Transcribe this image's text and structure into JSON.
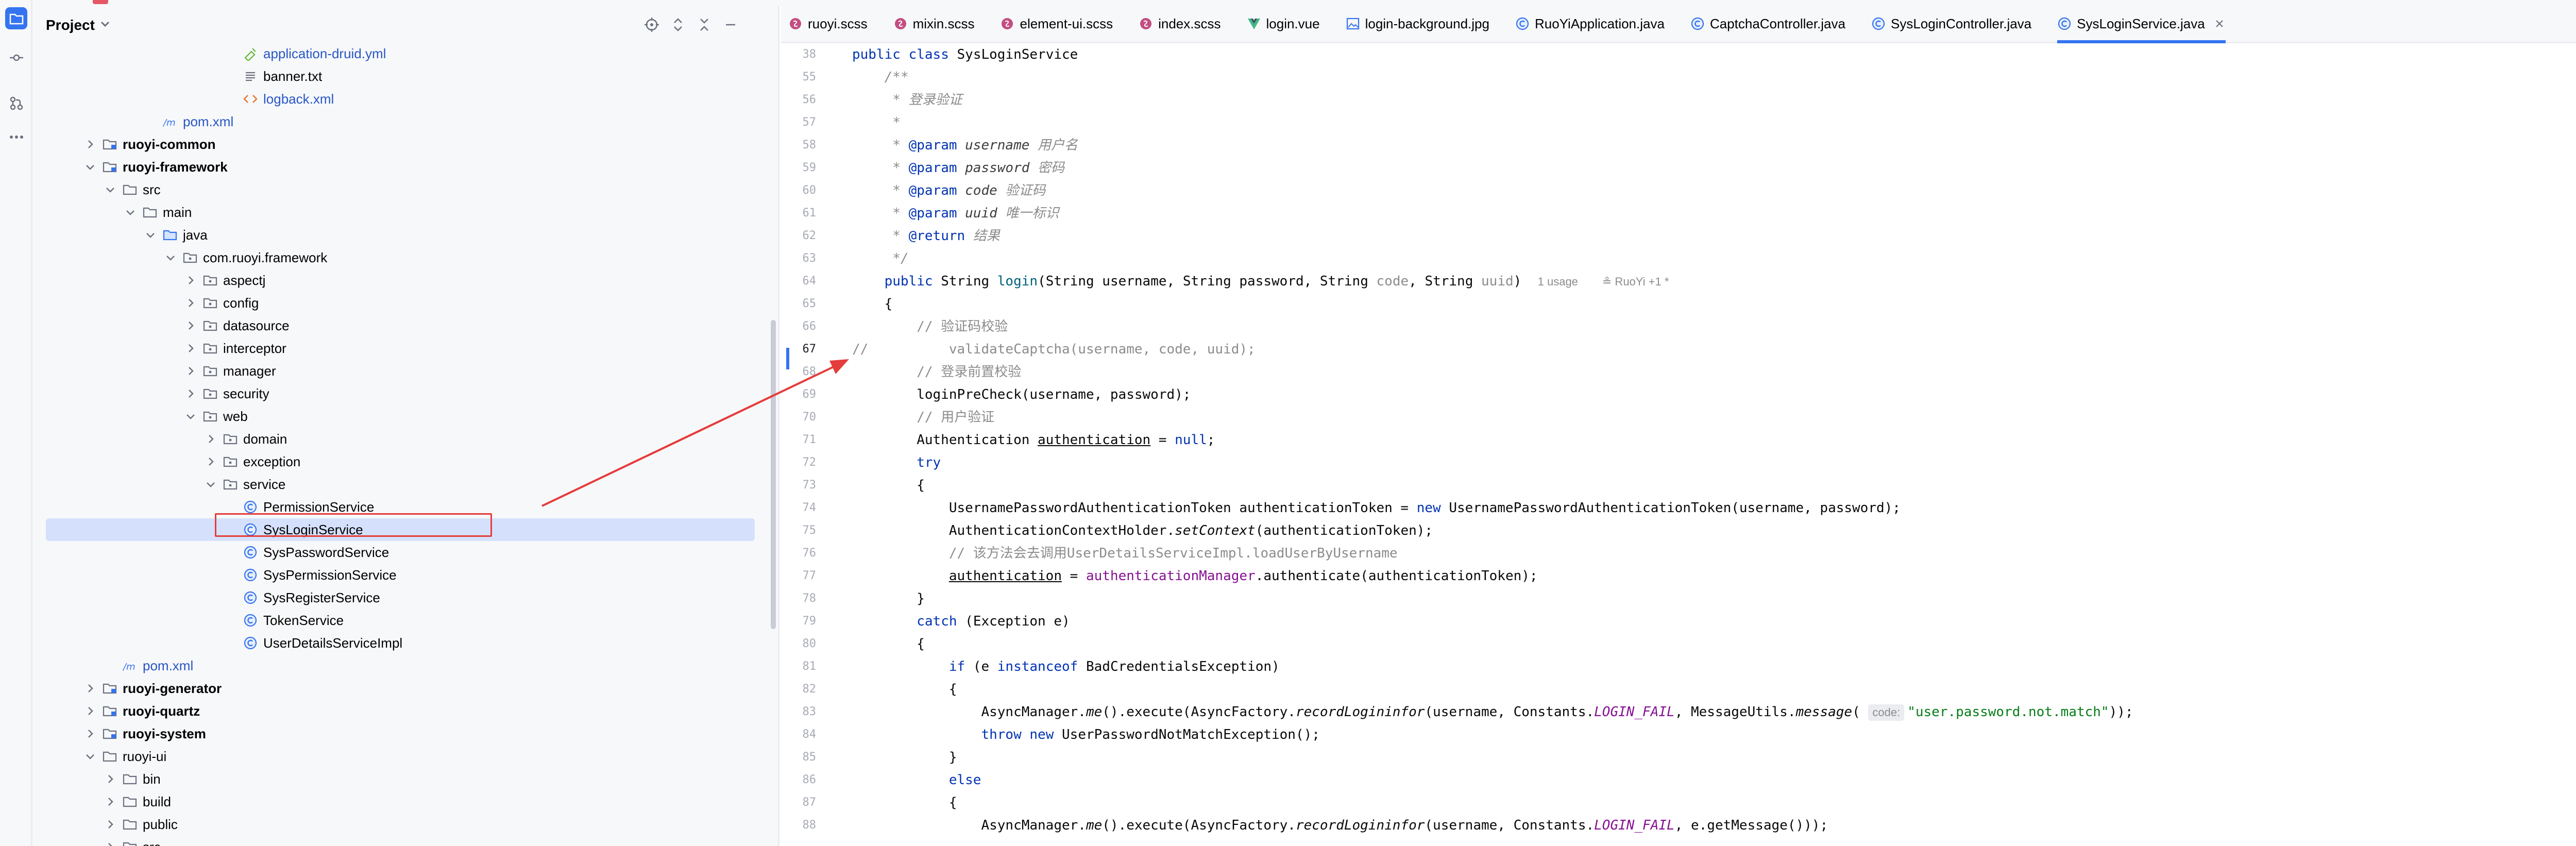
{
  "colors": {
    "accent": "#3574f0",
    "annotation_red": "#e53c3c",
    "keyword": "#0033b3",
    "comment": "#8c8c8c",
    "string": "#067d17",
    "method": "#00627a",
    "field": "#871094"
  },
  "activity_bar": {
    "icons": [
      "folder-icon",
      "commit-icon",
      "pull-requests-icon",
      "more-icon"
    ]
  },
  "project_panel": {
    "title": "Project",
    "header_icons": [
      "locate-icon",
      "expand-all-icon",
      "collapse-all-icon",
      "minimize-icon"
    ],
    "tree": [
      {
        "label": "application-druid.yml",
        "indent": 10,
        "arrow": "",
        "icon": "yaml-icon",
        "style": "blue"
      },
      {
        "label": "banner.txt",
        "indent": 10,
        "arrow": "",
        "icon": "text-icon",
        "style": ""
      },
      {
        "label": "logback.xml",
        "indent": 10,
        "arrow": "",
        "icon": "xml-icon",
        "style": "blue"
      },
      {
        "label": "pom.xml",
        "indent": 6,
        "arrow": "",
        "icon": "maven-icon",
        "style": "blue"
      },
      {
        "label": "ruoyi-common",
        "indent": 3,
        "arrow": "right",
        "icon": "module-icon",
        "style": "bold"
      },
      {
        "label": "ruoyi-framework",
        "indent": 3,
        "arrow": "down",
        "icon": "module-icon",
        "style": "bold"
      },
      {
        "label": "src",
        "indent": 4,
        "arrow": "down",
        "icon": "folder-icon",
        "style": ""
      },
      {
        "label": "main",
        "indent": 5,
        "arrow": "down",
        "icon": "folder-icon",
        "style": ""
      },
      {
        "label": "java",
        "indent": 6,
        "arrow": "down",
        "icon": "source-folder-icon",
        "style": ""
      },
      {
        "label": "com.ruoyi.framework",
        "indent": 7,
        "arrow": "down",
        "icon": "package-icon",
        "style": ""
      },
      {
        "label": "aspectj",
        "indent": 8,
        "arrow": "right",
        "icon": "package-icon",
        "style": ""
      },
      {
        "label": "config",
        "indent": 8,
        "arrow": "right",
        "icon": "package-icon",
        "style": ""
      },
      {
        "label": "datasource",
        "indent": 8,
        "arrow": "right",
        "icon": "package-icon",
        "style": ""
      },
      {
        "label": "interceptor",
        "indent": 8,
        "arrow": "right",
        "icon": "package-icon",
        "style": ""
      },
      {
        "label": "manager",
        "indent": 8,
        "arrow": "right",
        "icon": "package-icon",
        "style": ""
      },
      {
        "label": "security",
        "indent": 8,
        "arrow": "right",
        "icon": "package-icon",
        "style": ""
      },
      {
        "label": "web",
        "indent": 8,
        "arrow": "down",
        "icon": "package-icon",
        "style": ""
      },
      {
        "label": "domain",
        "indent": 9,
        "arrow": "right",
        "icon": "package-icon",
        "style": ""
      },
      {
        "label": "exception",
        "indent": 9,
        "arrow": "right",
        "icon": "package-icon",
        "style": ""
      },
      {
        "label": "service",
        "indent": 9,
        "arrow": "down",
        "icon": "package-icon",
        "style": ""
      },
      {
        "label": "PermissionService",
        "indent": 10,
        "arrow": "",
        "icon": "class-icon",
        "style": ""
      },
      {
        "label": "SysLoginService",
        "indent": 10,
        "arrow": "",
        "icon": "class-icon",
        "style": "",
        "selected": true
      },
      {
        "label": "SysPasswordService",
        "indent": 10,
        "arrow": "",
        "icon": "class-icon",
        "style": ""
      },
      {
        "label": "SysPermissionService",
        "indent": 10,
        "arrow": "",
        "icon": "class-icon",
        "style": ""
      },
      {
        "label": "SysRegisterService",
        "indent": 10,
        "arrow": "",
        "icon": "class-icon",
        "style": ""
      },
      {
        "label": "TokenService",
        "indent": 10,
        "arrow": "",
        "icon": "class-icon",
        "style": ""
      },
      {
        "label": "UserDetailsServiceImpl",
        "indent": 10,
        "arrow": "",
        "icon": "class-icon",
        "style": ""
      },
      {
        "label": "pom.xml",
        "indent": 4,
        "arrow": "",
        "icon": "maven-icon",
        "style": "blue"
      },
      {
        "label": "ruoyi-generator",
        "indent": 3,
        "arrow": "right",
        "icon": "module-icon",
        "style": "bold"
      },
      {
        "label": "ruoyi-quartz",
        "indent": 3,
        "arrow": "right",
        "icon": "module-icon",
        "style": "bold"
      },
      {
        "label": "ruoyi-system",
        "indent": 3,
        "arrow": "right",
        "icon": "module-icon",
        "style": "bold"
      },
      {
        "label": "ruoyi-ui",
        "indent": 3,
        "arrow": "down",
        "icon": "folder-icon",
        "style": ""
      },
      {
        "label": "bin",
        "indent": 4,
        "arrow": "right",
        "icon": "folder-icon",
        "style": ""
      },
      {
        "label": "build",
        "indent": 4,
        "arrow": "right",
        "icon": "folder-icon",
        "style": ""
      },
      {
        "label": "public",
        "indent": 4,
        "arrow": "right",
        "icon": "folder-icon",
        "style": ""
      },
      {
        "label": "src",
        "indent": 4,
        "arrow": "right",
        "icon": "folder-icon",
        "style": ""
      }
    ]
  },
  "tabs": [
    {
      "label": "ruoyi.scss",
      "icon": "scss-icon",
      "active": false
    },
    {
      "label": "mixin.scss",
      "icon": "scss-icon",
      "active": false
    },
    {
      "label": "element-ui.scss",
      "icon": "scss-icon",
      "active": false
    },
    {
      "label": "index.scss",
      "icon": "scss-icon",
      "active": false
    },
    {
      "label": "login.vue",
      "icon": "vue-icon",
      "active": false
    },
    {
      "label": "login-background.jpg",
      "icon": "image-icon",
      "active": false
    },
    {
      "label": "RuoYiApplication.java",
      "icon": "class-icon",
      "active": false
    },
    {
      "label": "CaptchaController.java",
      "icon": "class-icon",
      "active": false
    },
    {
      "label": "SysLoginController.java",
      "icon": "class-icon",
      "active": false
    },
    {
      "label": "SysLoginService.java",
      "icon": "class-icon",
      "active": true
    }
  ],
  "editor": {
    "current_line": 67,
    "sticky_header": {
      "line": "38",
      "text": "public class SysLoginService"
    },
    "lines": [
      {
        "n": "55",
        "tokens": [
          [
            "    ",
            ""
          ],
          [
            "/**",
            "jd"
          ]
        ]
      },
      {
        "n": "56",
        "tokens": [
          [
            "     * 登录验证",
            "jd"
          ]
        ]
      },
      {
        "n": "57",
        "tokens": [
          [
            "     *",
            "jd"
          ]
        ]
      },
      {
        "n": "58",
        "tokens": [
          [
            "     * ",
            "jd"
          ],
          [
            "@param",
            "jdtag"
          ],
          [
            " ",
            "jd"
          ],
          [
            "username",
            "jdparam"
          ],
          [
            " 用户名",
            "jd"
          ]
        ]
      },
      {
        "n": "59",
        "tokens": [
          [
            "     * ",
            "jd"
          ],
          [
            "@param",
            "jdtag"
          ],
          [
            " ",
            "jd"
          ],
          [
            "password",
            "jdparam"
          ],
          [
            " 密码",
            "jd"
          ]
        ]
      },
      {
        "n": "60",
        "tokens": [
          [
            "     * ",
            "jd"
          ],
          [
            "@param",
            "jdtag"
          ],
          [
            " ",
            "jd"
          ],
          [
            "code",
            "jdparam"
          ],
          [
            " 验证码",
            "jd"
          ]
        ]
      },
      {
        "n": "61",
        "tokens": [
          [
            "     * ",
            "jd"
          ],
          [
            "@param",
            "jdtag"
          ],
          [
            " ",
            "jd"
          ],
          [
            "uuid",
            "jdparam"
          ],
          [
            " 唯一标识",
            "jd"
          ]
        ]
      },
      {
        "n": "62",
        "tokens": [
          [
            "     * ",
            "jd"
          ],
          [
            "@return",
            "jdtag"
          ],
          [
            " 结果",
            "jd"
          ]
        ]
      },
      {
        "n": "63",
        "tokens": [
          [
            "     */",
            "jd"
          ]
        ]
      },
      {
        "n": "64",
        "tokens": [
          [
            "    ",
            ""
          ],
          [
            "public",
            "kw"
          ],
          [
            " String ",
            ""
          ],
          [
            "login",
            "mth"
          ],
          [
            "(String username, String password, String ",
            ""
          ],
          [
            "code",
            "gray"
          ],
          [
            ", String ",
            ""
          ],
          [
            "uuid",
            "gray"
          ],
          [
            ")  ",
            ""
          ],
          [
            "1 usage",
            "hint"
          ],
          [
            "   ",
            ""
          ],
          [
            "≗ RuoYi +1 *",
            "hint"
          ]
        ]
      },
      {
        "n": "65",
        "tokens": [
          [
            "    {",
            ""
          ]
        ]
      },
      {
        "n": "66",
        "tokens": [
          [
            "        ",
            ""
          ],
          [
            "// 验证码校验",
            "cm"
          ]
        ]
      },
      {
        "n": "67",
        "tokens": [
          [
            "//",
            "cm"
          ],
          [
            "          validateCaptcha(username, code, uuid);",
            "cm"
          ]
        ]
      },
      {
        "n": "68",
        "tokens": [
          [
            "        ",
            ""
          ],
          [
            "// 登录前置校验",
            "cm"
          ]
        ]
      },
      {
        "n": "69",
        "tokens": [
          [
            "        loginPreCheck(username, password);",
            ""
          ]
        ]
      },
      {
        "n": "70",
        "tokens": [
          [
            "        ",
            ""
          ],
          [
            "// 用户验证",
            "cm"
          ]
        ]
      },
      {
        "n": "71",
        "tokens": [
          [
            "        Authentication ",
            ""
          ],
          [
            "authentication",
            "under"
          ],
          [
            " = ",
            ""
          ],
          [
            "null",
            "kw"
          ],
          [
            ";",
            ""
          ]
        ]
      },
      {
        "n": "72",
        "tokens": [
          [
            "        ",
            ""
          ],
          [
            "try",
            "kw"
          ]
        ]
      },
      {
        "n": "73",
        "tokens": [
          [
            "        {",
            ""
          ]
        ]
      },
      {
        "n": "74",
        "tokens": [
          [
            "            UsernamePasswordAuthenticationToken authenticationToken = ",
            ""
          ],
          [
            "new",
            "kw"
          ],
          [
            " UsernamePasswordAuthenticationToken(username, password);",
            ""
          ]
        ]
      },
      {
        "n": "75",
        "tokens": [
          [
            "            AuthenticationContextHolder.",
            ""
          ],
          [
            "setContext",
            "ital"
          ],
          [
            "(authenticationToken);",
            ""
          ]
        ]
      },
      {
        "n": "76",
        "tokens": [
          [
            "            ",
            ""
          ],
          [
            "// 该方法会去调用UserDetailsServiceImpl.loadUserByUsername",
            "cm"
          ]
        ]
      },
      {
        "n": "77",
        "tokens": [
          [
            "            ",
            ""
          ],
          [
            "authentication",
            "under"
          ],
          [
            " = ",
            ""
          ],
          [
            "authenticationManager",
            "fld"
          ],
          [
            ".authenticate(authenticationToken);",
            ""
          ]
        ]
      },
      {
        "n": "78",
        "tokens": [
          [
            "        }",
            ""
          ]
        ]
      },
      {
        "n": "79",
        "tokens": [
          [
            "        ",
            ""
          ],
          [
            "catch",
            "kw"
          ],
          [
            " (Exception e)",
            ""
          ]
        ]
      },
      {
        "n": "80",
        "tokens": [
          [
            "        {",
            ""
          ]
        ]
      },
      {
        "n": "81",
        "tokens": [
          [
            "            ",
            ""
          ],
          [
            "if",
            "kw"
          ],
          [
            " (e ",
            ""
          ],
          [
            "instanceof",
            "kw"
          ],
          [
            " BadCredentialsException)",
            ""
          ]
        ]
      },
      {
        "n": "82",
        "tokens": [
          [
            "            {",
            ""
          ]
        ]
      },
      {
        "n": "83",
        "tokens": [
          [
            "                AsyncManager.",
            ""
          ],
          [
            "me",
            "ital"
          ],
          [
            "().execute(AsyncFactory.",
            ""
          ],
          [
            "recordLogininfor",
            "ital"
          ],
          [
            "(username, Constants.",
            ""
          ],
          [
            "LOGIN_FAIL",
            "fldi"
          ],
          [
            ", MessageUtils.",
            ""
          ],
          [
            "message",
            "ital"
          ],
          [
            "( ",
            ""
          ],
          [
            "code:",
            "inlay"
          ],
          [
            "\"user.password.not.match\"",
            "str"
          ],
          [
            "));",
            ""
          ]
        ]
      },
      {
        "n": "84",
        "tokens": [
          [
            "                ",
            ""
          ],
          [
            "throw",
            "kw"
          ],
          [
            " ",
            ""
          ],
          [
            "new",
            "kw"
          ],
          [
            " UserPasswordNotMatchException();",
            ""
          ]
        ]
      },
      {
        "n": "85",
        "tokens": [
          [
            "            }",
            ""
          ]
        ]
      },
      {
        "n": "86",
        "tokens": [
          [
            "            ",
            ""
          ],
          [
            "else",
            "kw"
          ]
        ]
      },
      {
        "n": "87",
        "tokens": [
          [
            "            {",
            ""
          ]
        ]
      },
      {
        "n": "88",
        "tokens": [
          [
            "                AsyncManager.",
            ""
          ],
          [
            "me",
            "ital"
          ],
          [
            "().execute(AsyncFactory.",
            ""
          ],
          [
            "recordLogininfor",
            "ital"
          ],
          [
            "(username, Constants.",
            ""
          ],
          [
            "LOGIN_FAIL",
            "fldi"
          ],
          [
            ", e.getMessage()));",
            ""
          ]
        ]
      }
    ]
  }
}
